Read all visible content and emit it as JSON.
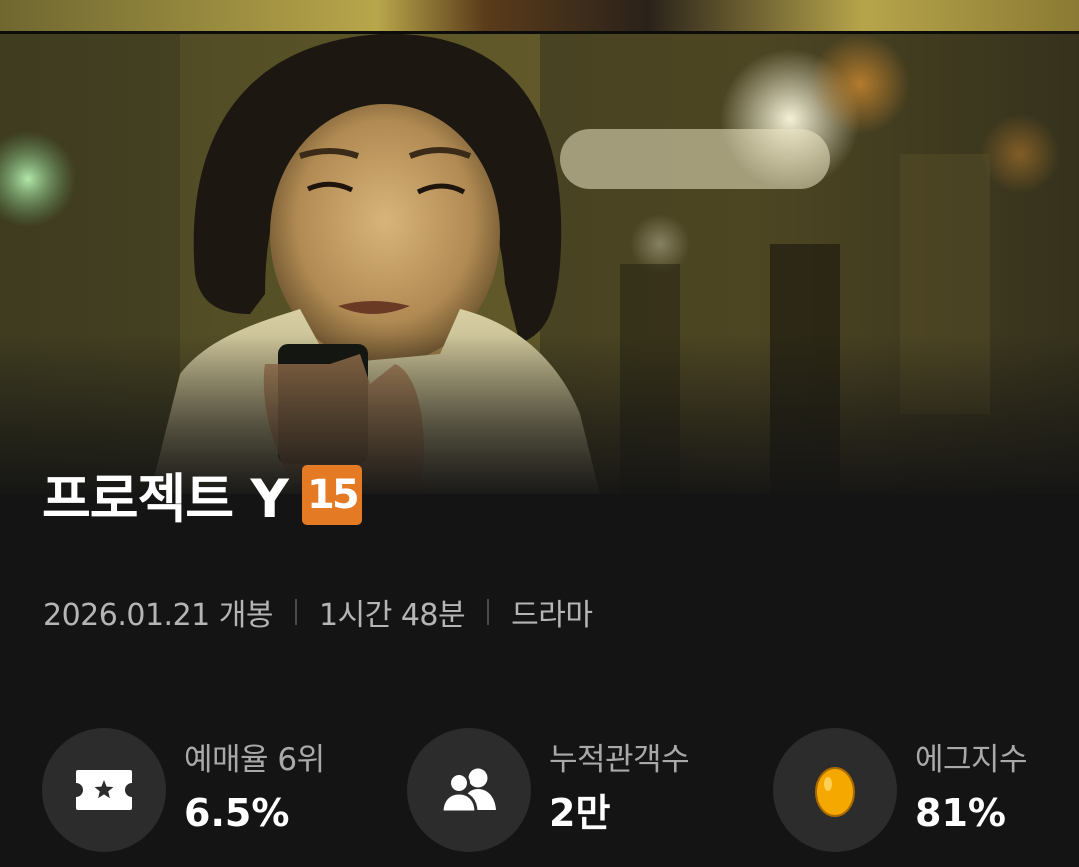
{
  "movie": {
    "title": "프로젝트 Y",
    "age_rating": "15",
    "release": "2026.01.21 개봉",
    "runtime": "1시간 48분",
    "genre": "드라마"
  },
  "stats": [
    {
      "label": "예매율 6위",
      "value": "6.5%",
      "icon": "ticket-icon"
    },
    {
      "label": "누적관객수",
      "value": "2만",
      "icon": "audience-icon"
    },
    {
      "label": "에그지수",
      "value": "81%",
      "icon": "golden-egg-icon"
    }
  ],
  "colors": {
    "background": "#141414",
    "age_badge": "#e57a25",
    "stat_circle": "#2c2c2c",
    "egg": "#f5a800"
  }
}
